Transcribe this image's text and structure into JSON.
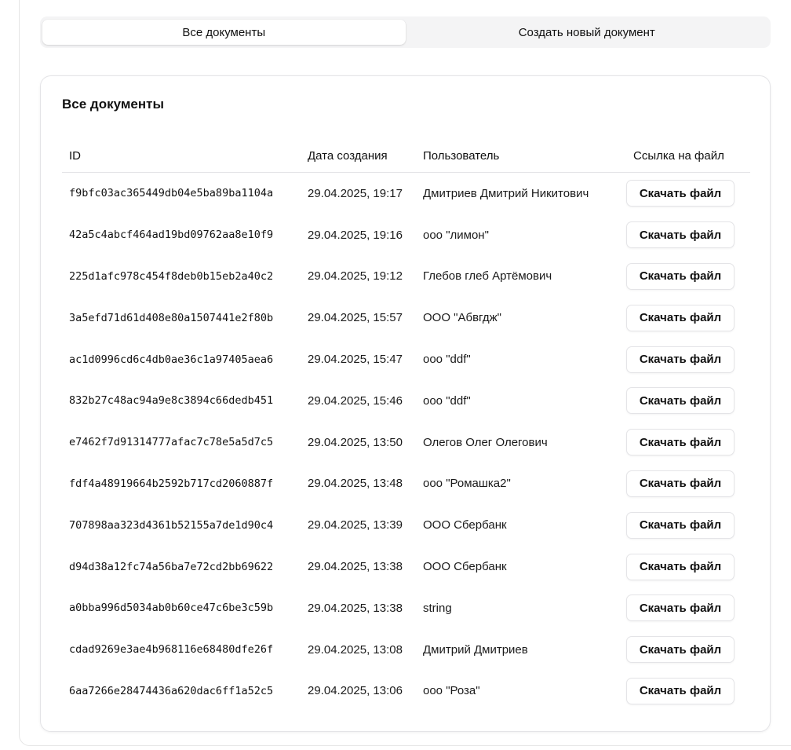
{
  "tabs": [
    {
      "label": "Все документы",
      "active": true
    },
    {
      "label": "Создать новый документ",
      "active": false
    }
  ],
  "card": {
    "title": "Все документы"
  },
  "table": {
    "headers": {
      "id": "ID",
      "date": "Дата создания",
      "user": "Пользователь",
      "link": "Ссылка на файл"
    },
    "download_label": "Скачать файл",
    "rows": [
      {
        "id": "f9bfc03ac365449db04e5ba89ba1104a",
        "date": "29.04.2025, 19:17",
        "user": "Дмитриев Дмитрий Никитович"
      },
      {
        "id": "42a5c4abcf464ad19bd09762aa8e10f9",
        "date": "29.04.2025, 19:16",
        "user": "ооо \"лимон\""
      },
      {
        "id": "225d1afc978c454f8deb0b15eb2a40c2",
        "date": "29.04.2025, 19:12",
        "user": "Глебов глеб Артёмович"
      },
      {
        "id": "3a5efd71d61d408e80a1507441e2f80b",
        "date": "29.04.2025, 15:57",
        "user": "ООО \"Абвгдж\""
      },
      {
        "id": "ac1d0996cd6c4db0ae36c1a97405aea6",
        "date": "29.04.2025, 15:47",
        "user": "ооо \"ddf\""
      },
      {
        "id": "832b27c48ac94a9e8c3894c66dedb451",
        "date": "29.04.2025, 15:46",
        "user": "ооо \"ddf\""
      },
      {
        "id": "e7462f7d91314777afac7c78e5a5d7c5",
        "date": "29.04.2025, 13:50",
        "user": "Олегов Олег Олегович"
      },
      {
        "id": "fdf4a48919664b2592b717cd2060887f",
        "date": "29.04.2025, 13:48",
        "user": "ооо \"Ромашка2\""
      },
      {
        "id": "707898aa323d4361b52155a7de1d90c4",
        "date": "29.04.2025, 13:39",
        "user": "ООО Сбербанк"
      },
      {
        "id": "d94d38a12fc74a56ba7e72cd2bb69622",
        "date": "29.04.2025, 13:38",
        "user": "ООО Сбербанк"
      },
      {
        "id": "a0bba996d5034ab0b60ce47c6be3c59b",
        "date": "29.04.2025, 13:38",
        "user": "string"
      },
      {
        "id": "cdad9269e3ae4b968116e68480dfe26f",
        "date": "29.04.2025, 13:08",
        "user": "Дмитрий Дмитриев"
      },
      {
        "id": "6aa7266e28474436a620dac6ff1a52c5",
        "date": "29.04.2025, 13:06",
        "user": "ооо \"Роза\""
      }
    ]
  }
}
